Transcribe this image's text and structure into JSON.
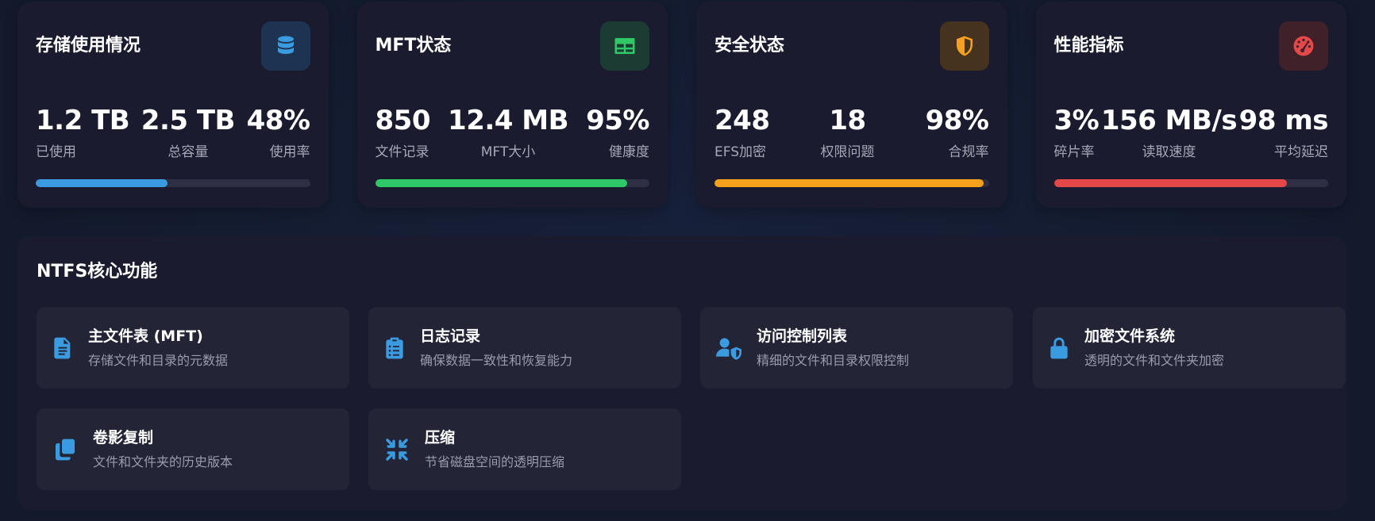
{
  "colors": {
    "blue": "#3b9be0",
    "green": "#2ec866",
    "orange": "#f5a11c",
    "red": "#e54848",
    "track": "#2e2f44"
  },
  "cards": [
    {
      "title": "存储使用情况",
      "icon": "database-icon",
      "stats": [
        {
          "value": "1.2 TB",
          "label": "已使用"
        },
        {
          "value": "2.5 TB",
          "label": "总容量"
        },
        {
          "value": "48%",
          "label": "使用率"
        }
      ],
      "progress_percent": 48
    },
    {
      "title": "MFT状态",
      "icon": "table-icon",
      "stats": [
        {
          "value": "850",
          "label": "文件记录"
        },
        {
          "value": "12.4 MB",
          "label": "MFT大小"
        },
        {
          "value": "95%",
          "label": "健康度"
        }
      ],
      "progress_percent": 92
    },
    {
      "title": "安全状态",
      "icon": "shield-icon",
      "stats": [
        {
          "value": "248",
          "label": "EFS加密"
        },
        {
          "value": "18",
          "label": "权限问题"
        },
        {
          "value": "98%",
          "label": "合规率"
        }
      ],
      "progress_percent": 98
    },
    {
      "title": "性能指标",
      "icon": "gauge-icon",
      "stats": [
        {
          "value": "3%",
          "label": "碎片率"
        },
        {
          "value": "156 MB/s",
          "label": "读取速度"
        },
        {
          "value": "98 ms",
          "label": "平均延迟"
        }
      ],
      "progress_percent": 85
    }
  ],
  "core": {
    "title": "NTFS核心功能",
    "features": [
      {
        "title": "主文件表 (MFT)",
        "desc": "存储文件和目录的元数据",
        "icon": "file-icon"
      },
      {
        "title": "日志记录",
        "desc": "确保数据一致性和恢复能力",
        "icon": "clipboard-list-icon"
      },
      {
        "title": "访问控制列表",
        "desc": "精细的文件和目录权限控制",
        "icon": "user-shield-icon"
      },
      {
        "title": "加密文件系统",
        "desc": "透明的文件和文件夹加密",
        "icon": "lock-icon"
      },
      {
        "title": "卷影复制",
        "desc": "文件和文件夹的历史版本",
        "icon": "copy-icon"
      },
      {
        "title": "压缩",
        "desc": "节省磁盘空间的透明压缩",
        "icon": "compress-icon"
      }
    ]
  }
}
